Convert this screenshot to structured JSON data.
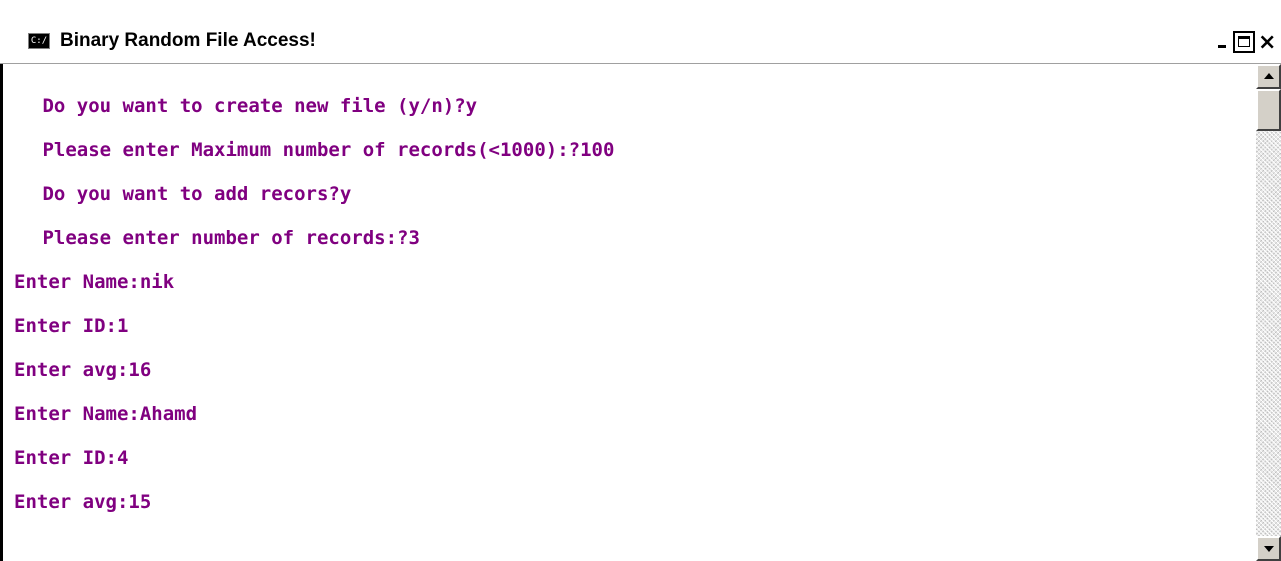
{
  "window": {
    "title": "Binary Random File Access!",
    "icon": "console-icon",
    "icon_glyph": "C:/",
    "text_color": "#800080"
  },
  "controls": {
    "minimize_icon": "minimize-icon",
    "maximize_icon": "maximize-icon",
    "close_icon": "close-icon",
    "close_glyph": "×"
  },
  "console": {
    "lines": [
      " Do you want to create new file (y/n)?y",
      " Please enter Maximum number of records(<1000):?100",
      " Do you want to add recors?y",
      " Please enter number of records:?3",
      "Enter Name:nik",
      "Enter ID:1",
      "Enter avg:16",
      "Enter Name:Ahamd",
      "Enter ID:4",
      "Enter avg:15"
    ]
  },
  "scrollbar": {
    "up_icon": "scroll-up-arrow-icon",
    "down_icon": "scroll-down-arrow-icon"
  }
}
